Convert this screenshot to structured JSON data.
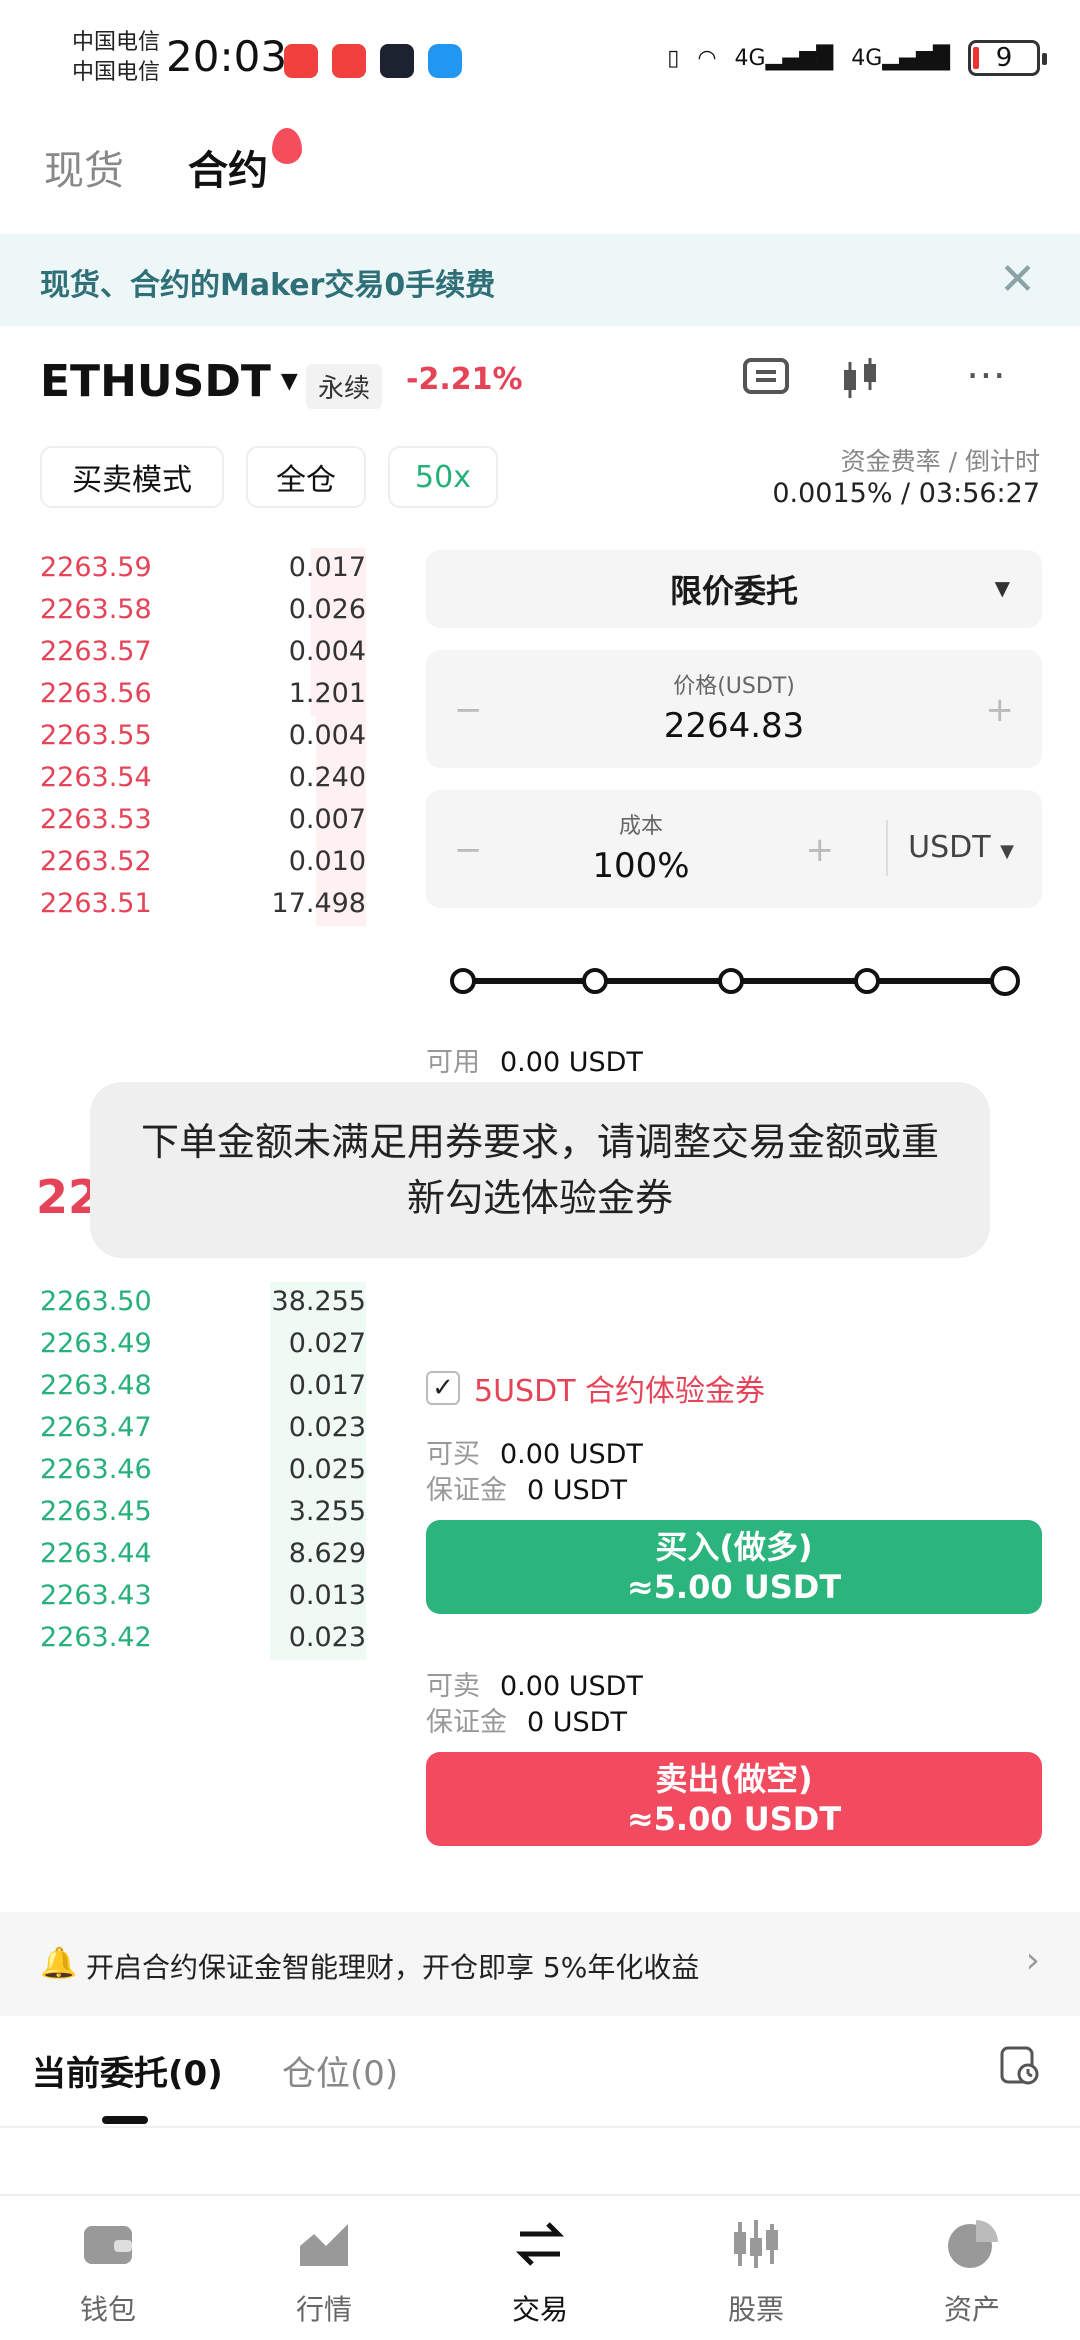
{
  "status": {
    "carrier1": "中国电信",
    "carrier2": "中国电信",
    "time": "20:03",
    "network1": "4G",
    "network2": "4G",
    "battery": "9"
  },
  "top_tabs": [
    "现货",
    "合约"
  ],
  "banner": {
    "text": "现货、合约的Maker交易0手续费",
    "close": "✕"
  },
  "instrument": {
    "symbol": "ETHUSDT",
    "type": "永续",
    "change": "-2.21%",
    "mode_button": "买卖模式",
    "margin_button": "全仓",
    "leverage_button": "50x",
    "funding_label": "资金费率 / 倒计时",
    "funding_value": "0.0015% / 03:56:27"
  },
  "asks": [
    {
      "price": "2263.59",
      "qty": "0.017",
      "depth": 0.22
    },
    {
      "price": "2263.58",
      "qty": "0.026",
      "depth": 0.22
    },
    {
      "price": "2263.57",
      "qty": "0.004",
      "depth": 0.22
    },
    {
      "price": "2263.56",
      "qty": "1.201",
      "depth": 0.22
    },
    {
      "price": "2263.55",
      "qty": "0.004",
      "depth": 0.2
    },
    {
      "price": "2263.54",
      "qty": "0.240",
      "depth": 0.2
    },
    {
      "price": "2263.53",
      "qty": "0.007",
      "depth": 0.2
    },
    {
      "price": "2263.52",
      "qty": "0.010",
      "depth": 0.2
    },
    {
      "price": "2263.51",
      "qty": "17.498",
      "depth": 0.2
    }
  ],
  "mid_price": "22",
  "bids": [
    {
      "price": "2263.50",
      "qty": "38.255",
      "depth": 0.38
    },
    {
      "price": "2263.49",
      "qty": "0.027",
      "depth": 0.38
    },
    {
      "price": "2263.48",
      "qty": "0.017",
      "depth": 0.38
    },
    {
      "price": "2263.47",
      "qty": "0.023",
      "depth": 0.38
    },
    {
      "price": "2263.46",
      "qty": "0.025",
      "depth": 0.38
    },
    {
      "price": "2263.45",
      "qty": "3.255",
      "depth": 0.38
    },
    {
      "price": "2263.44",
      "qty": "8.629",
      "depth": 0.38
    },
    {
      "price": "2263.43",
      "qty": "0.013",
      "depth": 0.38
    },
    {
      "price": "2263.42",
      "qty": "0.023",
      "depth": 0.38
    }
  ],
  "form": {
    "order_type": "限价委托",
    "price_label": "价格(USDT)",
    "price_value": "2264.83",
    "cost_label": "成本",
    "cost_value": "100%",
    "unit": "USDT",
    "minus": "−",
    "plus": "+",
    "avail_label": "可用",
    "avail_value": "0.00 USDT",
    "coupon": "5USDT 合约体验金券",
    "buyable_label": "可买",
    "buyable_value": "0.00 USDT",
    "margin_label": "保证金",
    "margin_buy_value": "0 USDT",
    "buy_title": "买入(做多)",
    "buy_amount": "≈5.00 USDT",
    "sellable_label": "可卖",
    "sellable_value": "0.00 USDT",
    "margin_sell_value": "0 USDT",
    "sell_title": "卖出(做空)",
    "sell_amount": "≈5.00 USDT"
  },
  "toast": "下单金额未满足用券要求，请调整交易金额或重新勾选体验金券",
  "promo": {
    "text": "开启合约保证金智能理财，开仓即享 5%年化收益"
  },
  "order_tabs": {
    "current": "当前委托(0)",
    "position": "仓位(0)"
  },
  "bottom_nav": [
    "钱包",
    "行情",
    "交易",
    "股票",
    "资产"
  ]
}
